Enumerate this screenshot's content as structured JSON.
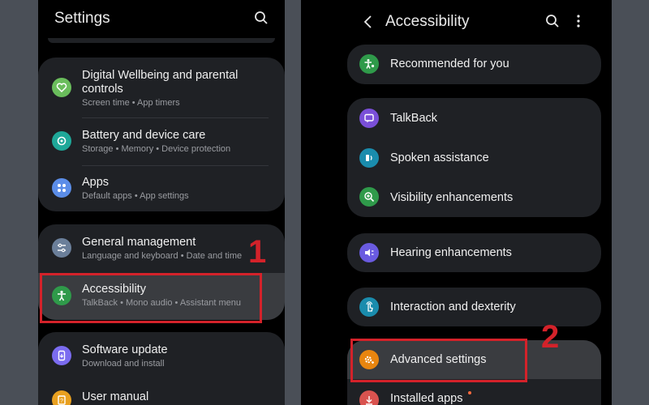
{
  "left": {
    "title": "Settings",
    "items": [
      {
        "title": "Digital Wellbeing and parental controls",
        "title_line1": "Digital Wellbeing and parental",
        "title_line2": "controls",
        "subtitle": "Screen time  •  App timers",
        "icon": "heart-icon",
        "color": "#6abd5c"
      },
      {
        "title": "Battery and device care",
        "subtitle": "Storage  •  Memory  •  Device protection",
        "icon": "battery-care-icon",
        "color": "#1fa899"
      },
      {
        "title": "Apps",
        "subtitle": "Default apps  •  App settings",
        "icon": "apps-grid-icon",
        "color": "#5b8de8"
      },
      {
        "title": "General management",
        "subtitle": "Language and keyboard  •  Date and time",
        "icon": "sliders-icon",
        "color": "#6b7f9a"
      },
      {
        "title": "Accessibility",
        "subtitle": "TalkBack  •  Mono audio  •  Assistant menu",
        "icon": "accessibility-icon",
        "color": "#2f9a4a"
      },
      {
        "title": "Software update",
        "subtitle": "Download and install",
        "icon": "update-icon",
        "color": "#7b6cf0"
      },
      {
        "title": "User manual",
        "subtitle": "",
        "icon": "manual-icon",
        "color": "#e8a020"
      }
    ],
    "annotation": "1"
  },
  "right": {
    "title": "Accessibility",
    "items": [
      {
        "title": "Recommended for you",
        "icon": "accessibility-star-icon",
        "color": "#2f9a4a"
      },
      {
        "title": "TalkBack",
        "icon": "talkback-icon",
        "color": "#7a4fd8"
      },
      {
        "title": "Spoken assistance",
        "icon": "spoken-icon",
        "color": "#1a8cad"
      },
      {
        "title": "Visibility enhancements",
        "icon": "magnify-icon",
        "color": "#2f9a4a"
      },
      {
        "title": "Hearing enhancements",
        "icon": "hearing-icon",
        "color": "#6a5be0"
      },
      {
        "title": "Interaction and dexterity",
        "icon": "touch-icon",
        "color": "#1a8cad"
      },
      {
        "title": "Advanced settings",
        "icon": "gear-plus-icon",
        "color": "#e8850f"
      },
      {
        "title": "Installed apps",
        "icon": "download-icon",
        "color": "#d9534f"
      }
    ],
    "annotation": "2"
  }
}
